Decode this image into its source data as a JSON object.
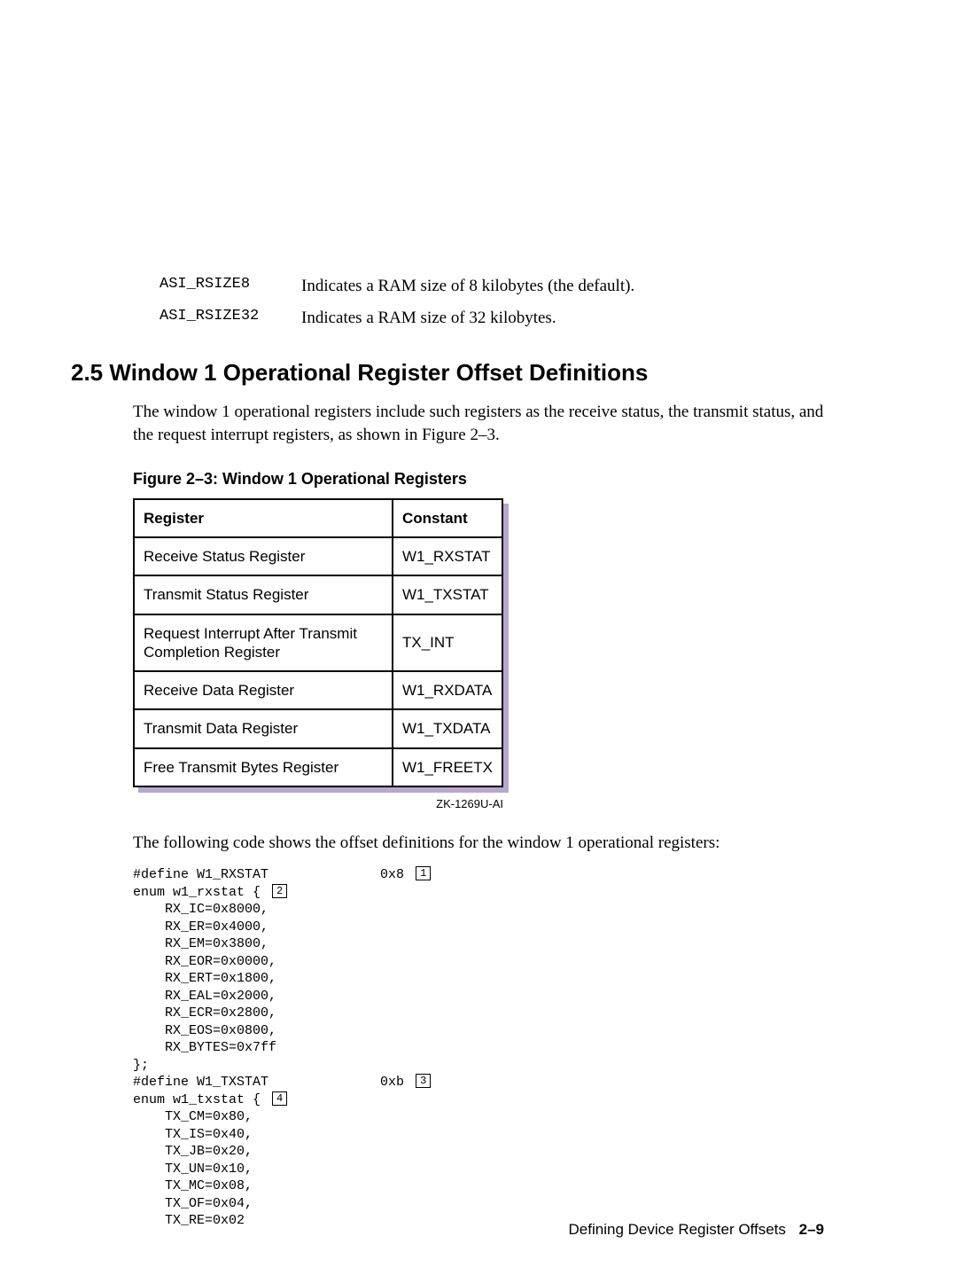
{
  "defs": [
    {
      "term": "ASI_RSIZE8",
      "desc": "Indicates a RAM size of 8 kilobytes (the default)."
    },
    {
      "term": "ASI_RSIZE32",
      "desc": "Indicates a RAM size of 32 kilobytes."
    }
  ],
  "section": {
    "number": "2.5",
    "title": "Window 1 Operational Register Offset Definitions"
  },
  "para1": "The window 1 operational registers include such registers as the receive status, the transmit status, and the request interrupt registers, as shown in Figure 2–3.",
  "figure": {
    "caption": "Figure 2–3:  Window 1 Operational Registers",
    "headers": {
      "c1": "Register",
      "c2": "Constant"
    },
    "rows": [
      {
        "reg": "Receive Status Register",
        "const": "W1_RXSTAT"
      },
      {
        "reg": "Transmit Status Register",
        "const": "W1_TXSTAT"
      },
      {
        "reg": "Request Interrupt After Transmit Completion Register",
        "const": "TX_INT"
      },
      {
        "reg": "Receive Data Register",
        "const": "W1_RXDATA"
      },
      {
        "reg": "Transmit Data Register",
        "const": "W1_TXDATA"
      },
      {
        "reg": "Free Transmit Bytes Register",
        "const": "W1_FREETX"
      }
    ],
    "code": "ZK-1269U-AI"
  },
  "para2": "The following code shows the offset definitions for the window 1 operational registers:",
  "code": {
    "l1a": "#define W1_RXSTAT              0x8 ",
    "l1c": "1",
    "l2a": "enum w1_rxstat { ",
    "l2c": "2",
    "l3": "    RX_IC=0x8000,",
    "l4": "    RX_ER=0x4000,",
    "l5": "    RX_EM=0x3800,",
    "l6": "    RX_EOR=0x0000,",
    "l7": "    RX_ERT=0x1800,",
    "l8": "    RX_EAL=0x2000,",
    "l9": "    RX_ECR=0x2800,",
    "l10": "    RX_EOS=0x0800,",
    "l11": "    RX_BYTES=0x7ff",
    "l12": "};",
    "l13a": "#define W1_TXSTAT              0xb ",
    "l13c": "3",
    "l14a": "enum w1_txstat { ",
    "l14c": "4",
    "l15": "    TX_CM=0x80,",
    "l16": "    TX_IS=0x40,",
    "l17": "    TX_JB=0x20,",
    "l18": "    TX_UN=0x10,",
    "l19": "    TX_MC=0x08,",
    "l20": "    TX_OF=0x04,",
    "l21": "    TX_RE=0x02"
  },
  "footer": {
    "title": "Defining Device Register Offsets",
    "page": "2–9"
  }
}
